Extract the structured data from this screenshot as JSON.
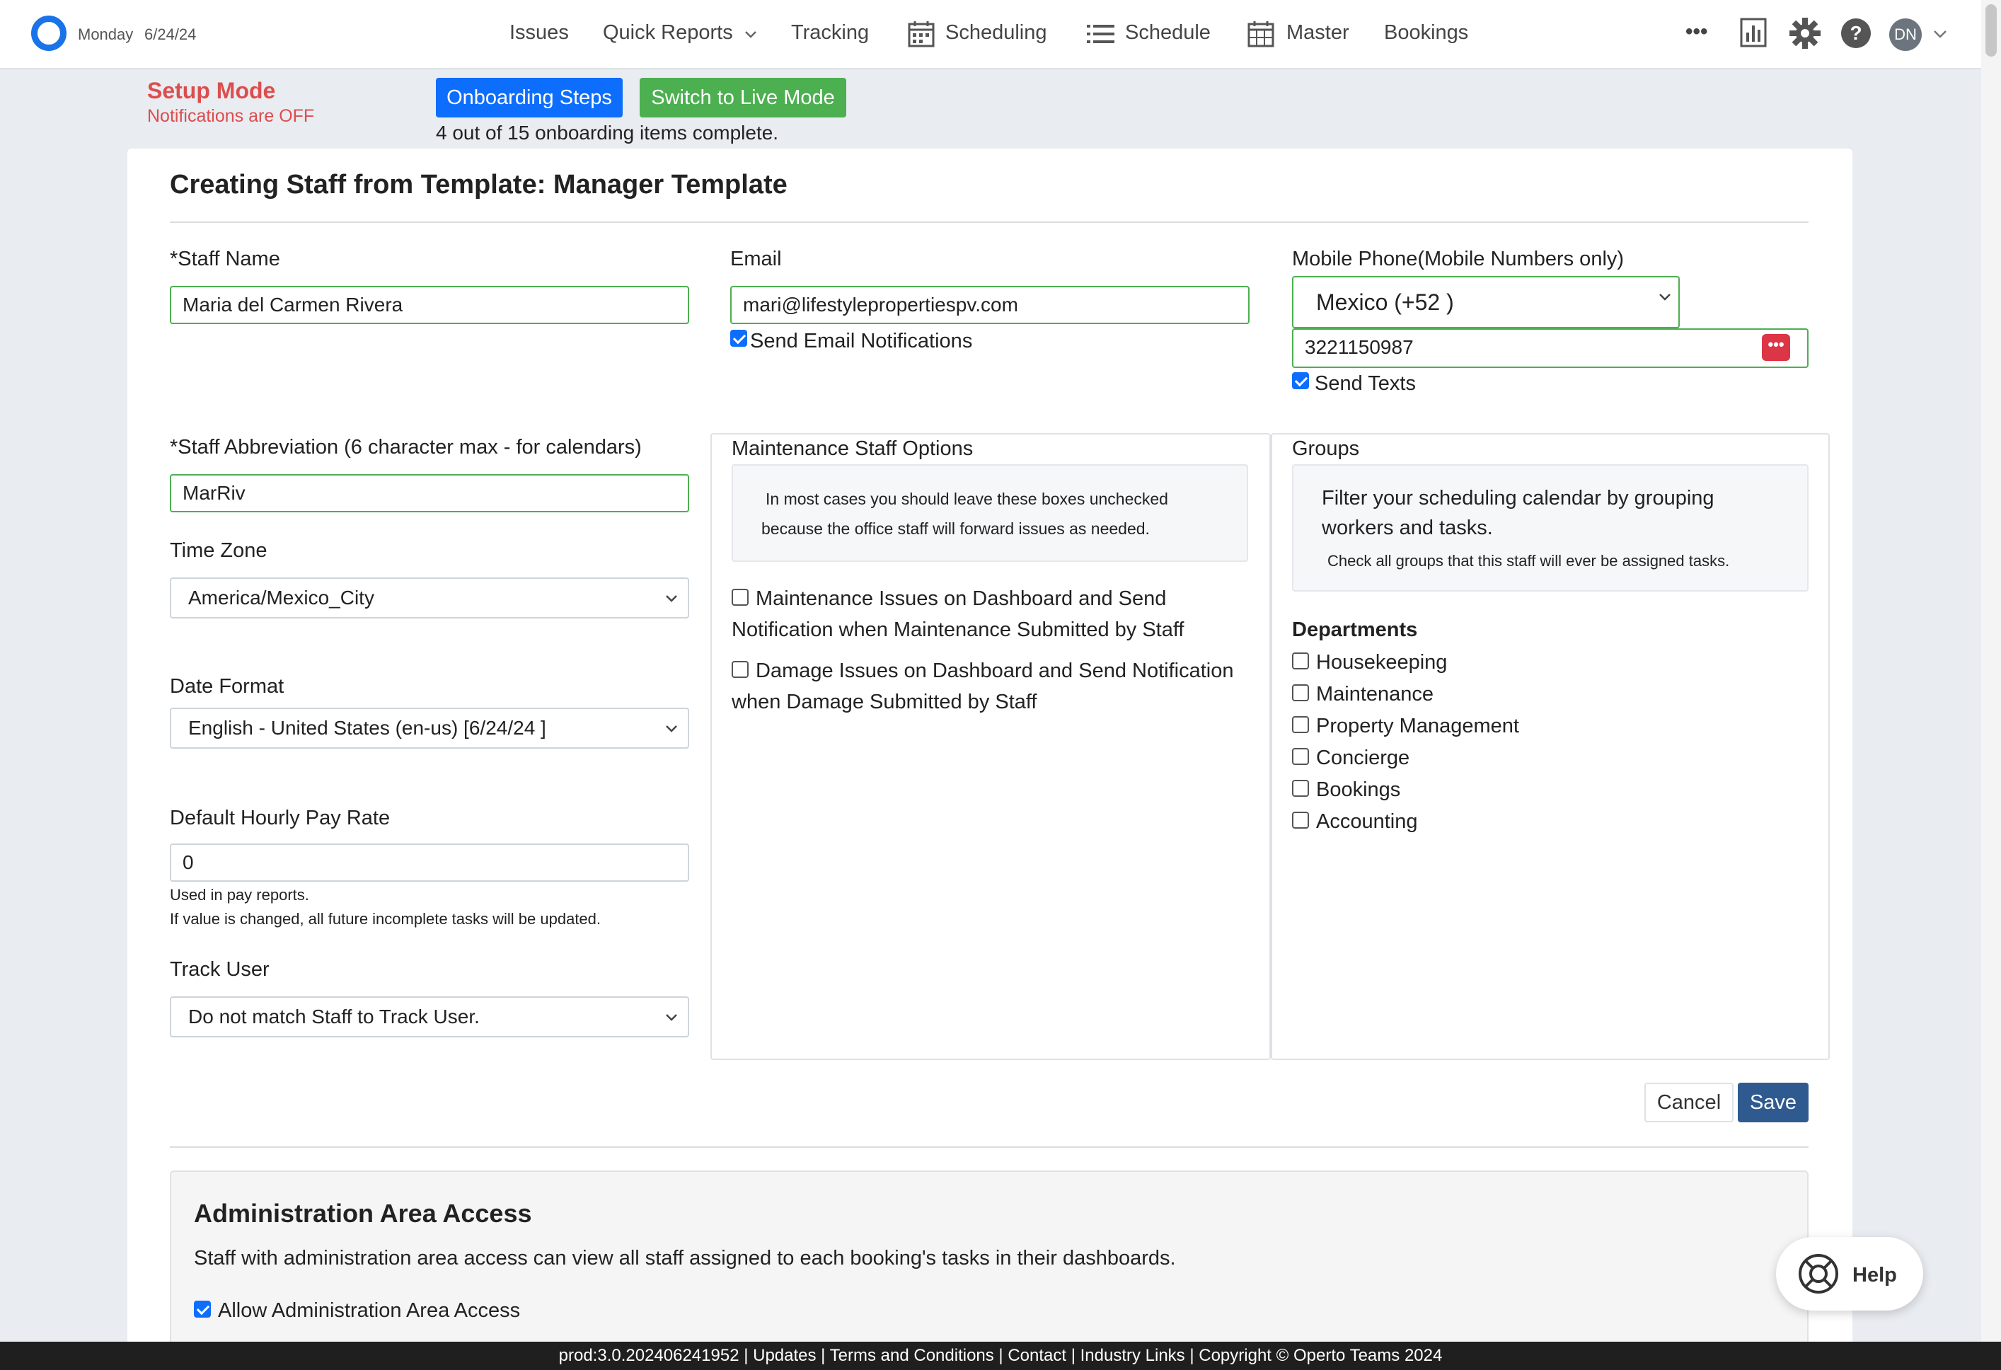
{
  "header": {
    "day": "Monday",
    "date": "6/24/24",
    "nav": {
      "issues": "Issues",
      "quick_reports": "Quick Reports",
      "tracking": "Tracking",
      "scheduling": "Scheduling",
      "schedule": "Schedule",
      "master": "Master",
      "bookings": "Bookings"
    },
    "more": "•••",
    "avatar": "DN"
  },
  "setup": {
    "title": "Setup Mode",
    "subtitle": "Notifications are OFF",
    "onboarding_button": "Onboarding Steps",
    "live_button": "Switch to Live Mode",
    "progress": "4 out of 15 onboarding items complete."
  },
  "form": {
    "title": "Creating Staff from Template: Manager Template",
    "staff_name": {
      "label": "*Staff Name",
      "value": "Maria del Carmen Rivera"
    },
    "email": {
      "label": "Email",
      "value": "mari@lifestylepropertiespv.com",
      "notify_label": "Send Email Notifications",
      "notify_checked": true
    },
    "mobile": {
      "label": "Mobile Phone(Mobile Numbers only)",
      "country": "Mexico (+52 )",
      "number": "3221150987",
      "texts_label": "Send Texts",
      "texts_checked": true,
      "dots": "•••"
    },
    "abbreviation": {
      "label": "*Staff Abbreviation (6 character max - for calendars)",
      "value": "MarRiv"
    },
    "time_zone": {
      "label": "Time Zone",
      "value": "America/Mexico_City"
    },
    "date_format": {
      "label": "Date Format",
      "value": "English - United States (en-us) [6/24/24 ]"
    },
    "pay_rate": {
      "label": "Default Hourly Pay Rate",
      "value": "0",
      "note1": "Used in pay reports.",
      "note2": "If value is changed, all future incomplete tasks will be updated."
    },
    "track_user": {
      "label": "Track User",
      "value": "Do not match Staff to Track User."
    },
    "maintenance": {
      "legend": "Maintenance Staff Options",
      "info_line1": "In most cases you should leave these boxes unchecked",
      "info_line2": "because the office staff will forward issues as needed.",
      "opt1_line1": "Maintenance Issues on Dashboard and Send",
      "opt1_line2": "Notification when Maintenance Submitted by Staff",
      "opt2_line1": "Damage Issues on Dashboard and Send Notification",
      "opt2_line2": "when Damage Submitted by Staff"
    },
    "groups": {
      "legend": "Groups",
      "info_line1": "Filter your scheduling calendar by grouping",
      "info_line2": "workers and tasks.",
      "info_line3": "Check all groups that this staff will ever be assigned tasks.",
      "departments_heading": "Departments",
      "departments": [
        "Housekeeping",
        "Maintenance",
        "Property Management",
        "Concierge",
        "Bookings",
        "Accounting"
      ]
    },
    "cancel": "Cancel",
    "save": "Save"
  },
  "admin": {
    "title": "Administration Area Access",
    "description": "Staff with administration area access can view all staff assigned to each booking's tasks in their dashboards.",
    "allow_label": "Allow Administration Area Access",
    "allow_checked": true
  },
  "help": {
    "label": "Help"
  },
  "footer": {
    "text": "prod:3.0.202406241952 | Updates | Terms and Conditions | Contact | Industry Links | Copyright © Operto Teams 2024"
  },
  "colors": {
    "primary": "#0d6efd",
    "success": "#4caf50",
    "danger": "#dc4d4d",
    "save": "#2f5a8f"
  }
}
